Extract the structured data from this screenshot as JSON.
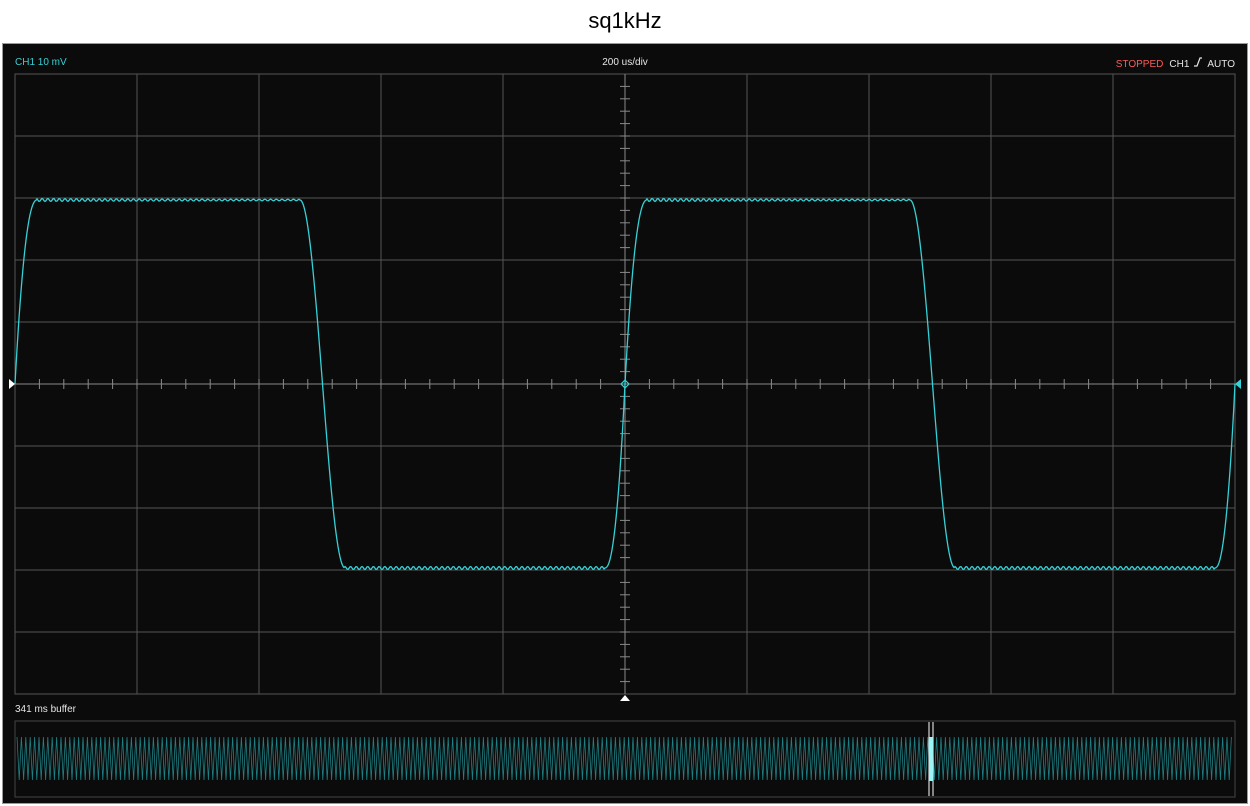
{
  "window": {
    "title": "sq1kHz"
  },
  "scope": {
    "channel_label": "CH1 10 mV",
    "timebase": "200 us/div",
    "status": "STOPPED",
    "trigger_source": "CH1",
    "trigger_mode": "AUTO",
    "buffer_label": "341 ms buffer"
  },
  "colors": {
    "trace": "#36d1d6",
    "grid": "#555555",
    "background": "#0b0b0b",
    "status": "#ff5a5a"
  },
  "icons": {
    "trigger_edge": "rising-edge-icon",
    "trigger_level_marker": "triangle-left-icon",
    "ground_marker": "triangle-right-icon",
    "trigger_position_marker": "triangle-up-icon"
  }
}
